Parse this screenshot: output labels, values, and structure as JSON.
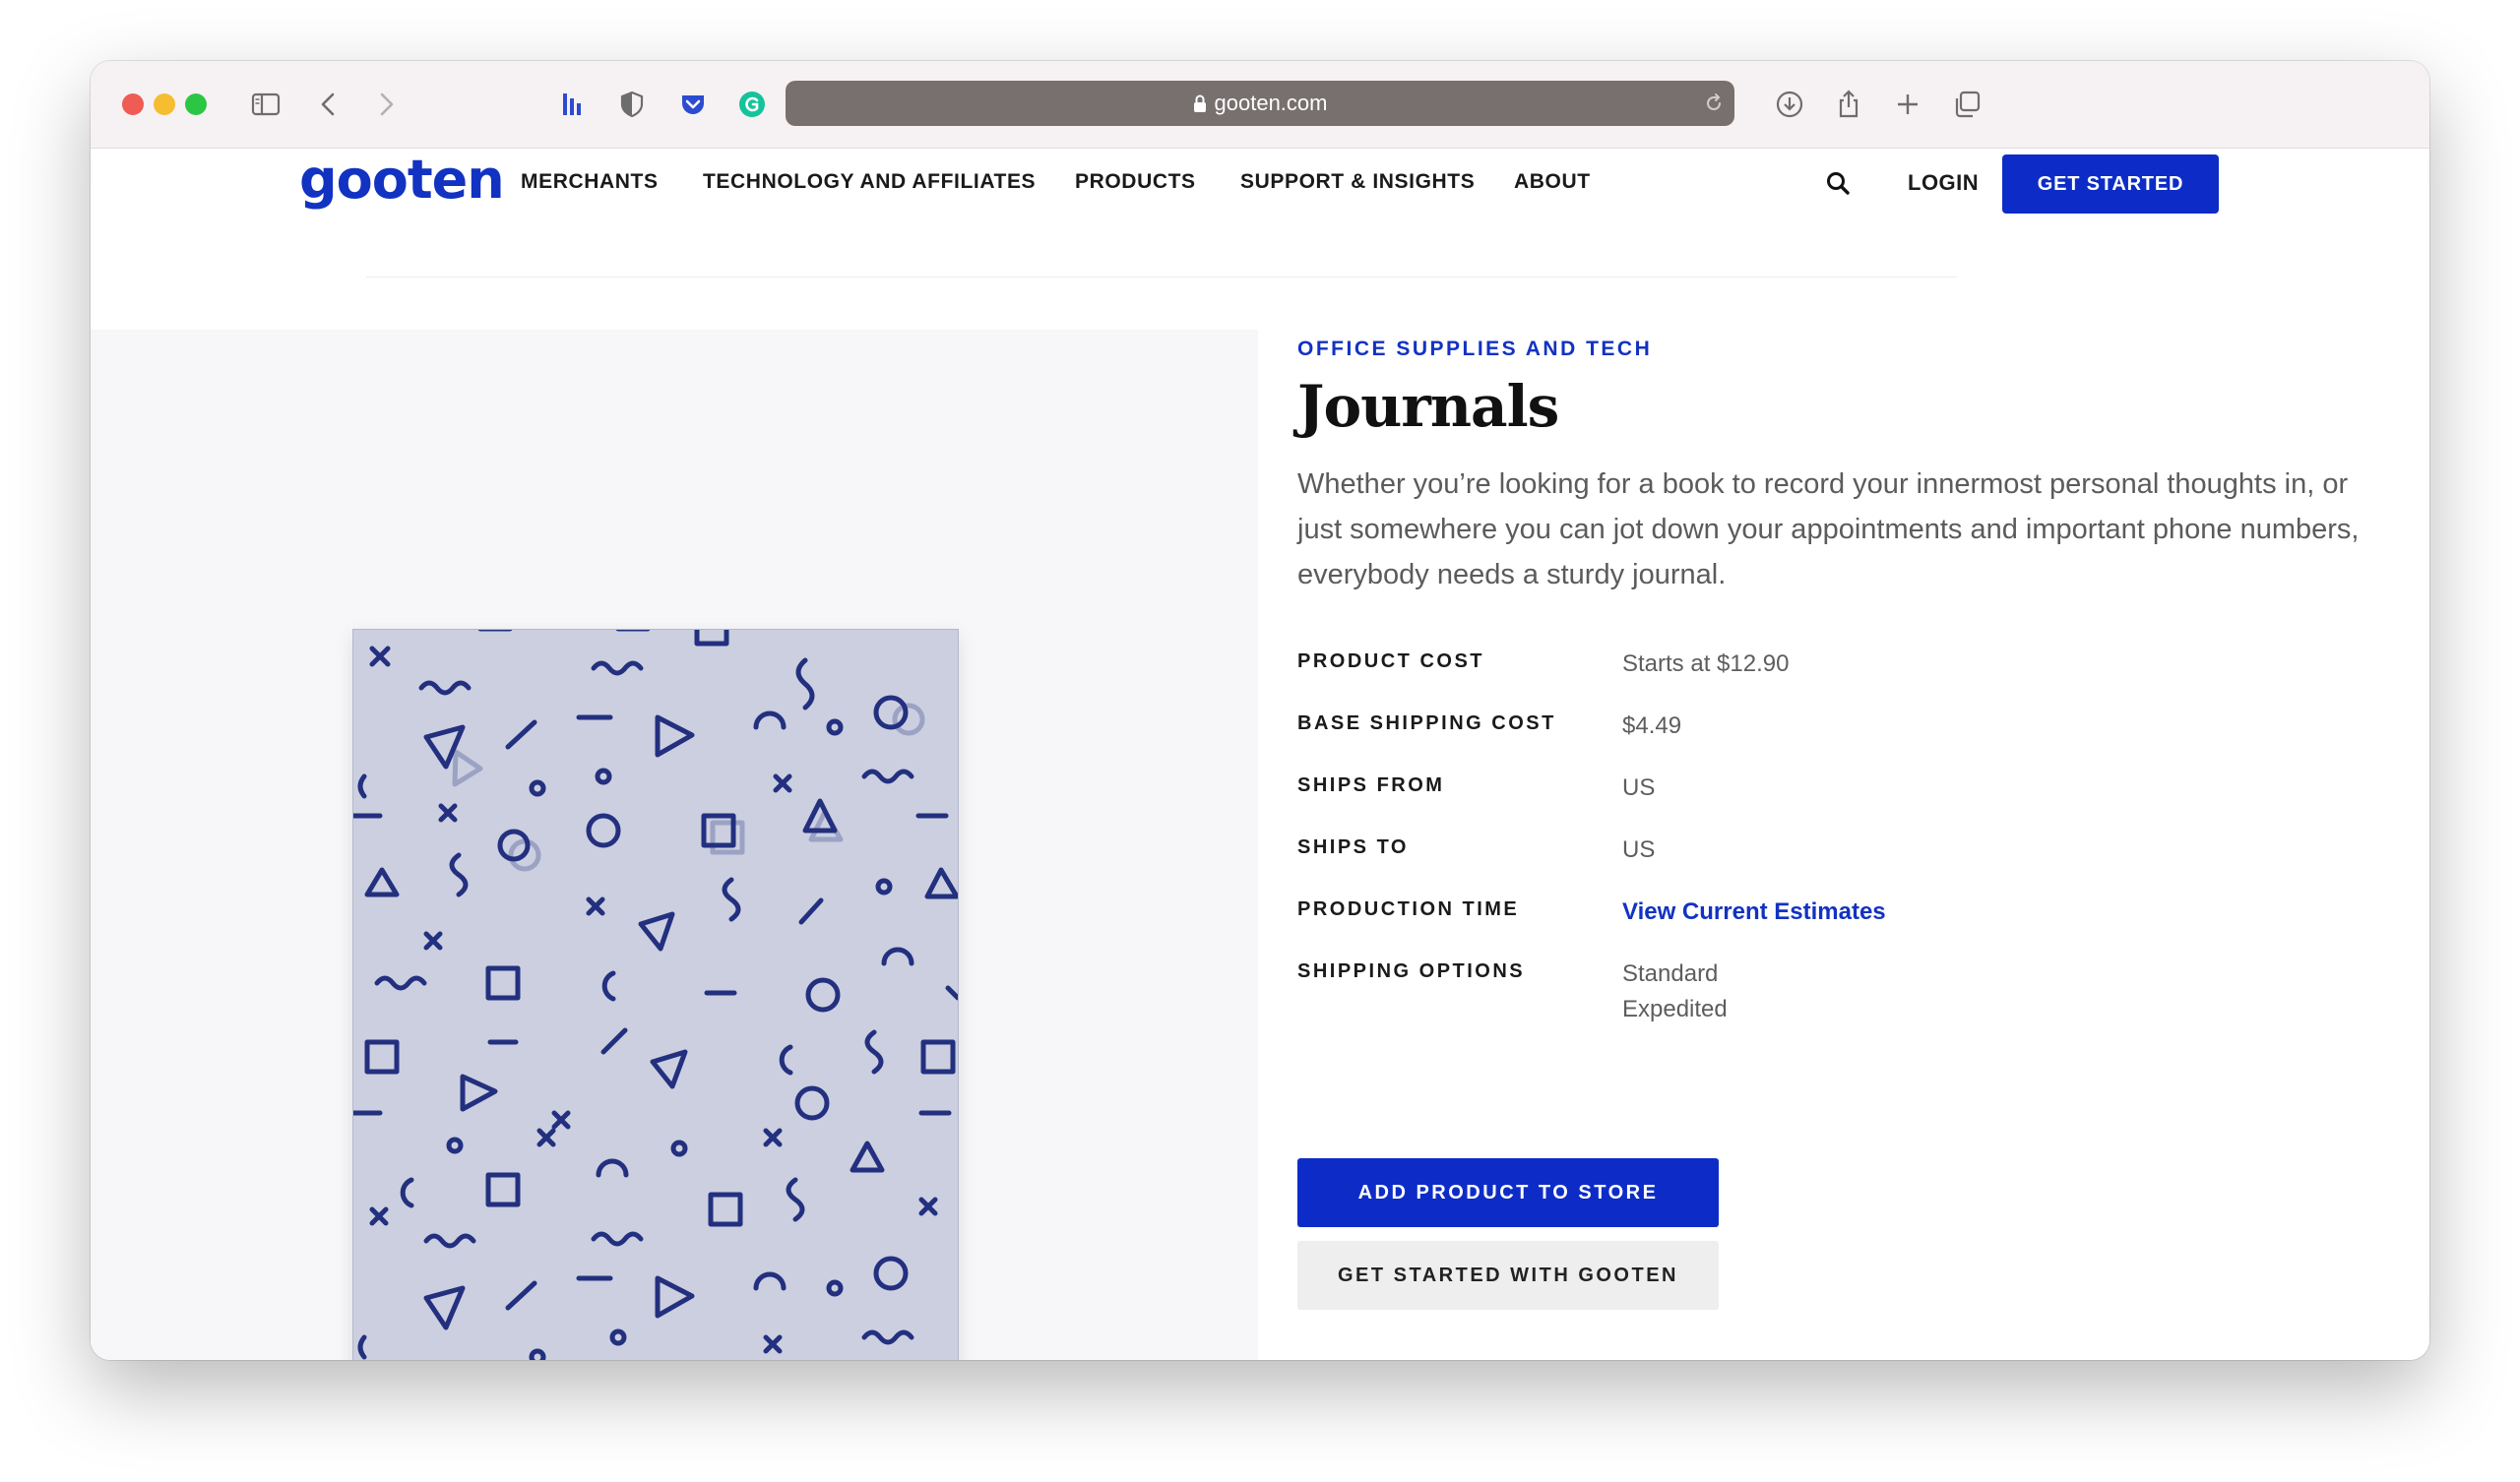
{
  "browser": {
    "url": "gooten.com"
  },
  "nav": {
    "logo": "gooten",
    "items": [
      "MERCHANTS",
      "TECHNOLOGY AND AFFILIATES",
      "PRODUCTS",
      "SUPPORT & INSIGHTS",
      "ABOUT"
    ],
    "login": "LOGIN",
    "get_started": "GET STARTED"
  },
  "product": {
    "category": "OFFICE SUPPLIES AND TECH",
    "title": "Journals",
    "description": "Whether you’re looking for a book to record your innermost personal thoughts in, or just somewhere you can jot down your appointments and important phone numbers, everybody needs a sturdy journal.",
    "specs": [
      {
        "label": "PRODUCT COST",
        "value": "Starts at $12.90"
      },
      {
        "label": "BASE SHIPPING COST",
        "value": "$4.49"
      },
      {
        "label": "SHIPS FROM",
        "value": "US"
      },
      {
        "label": "SHIPS TO",
        "value": "US"
      },
      {
        "label": "PRODUCTION TIME",
        "value": "View Current Estimates"
      },
      {
        "label": "SHIPPING OPTIONS",
        "value": "Standard",
        "value2": "Expedited"
      }
    ],
    "add_button": "ADD PRODUCT TO STORE",
    "start_button": "GET STARTED WITH GOOTEN"
  },
  "colors": {
    "brand": "#1232c2",
    "button": "#0d2cc7",
    "journal_cover": "#c4c8db",
    "pattern": "#23307f"
  }
}
